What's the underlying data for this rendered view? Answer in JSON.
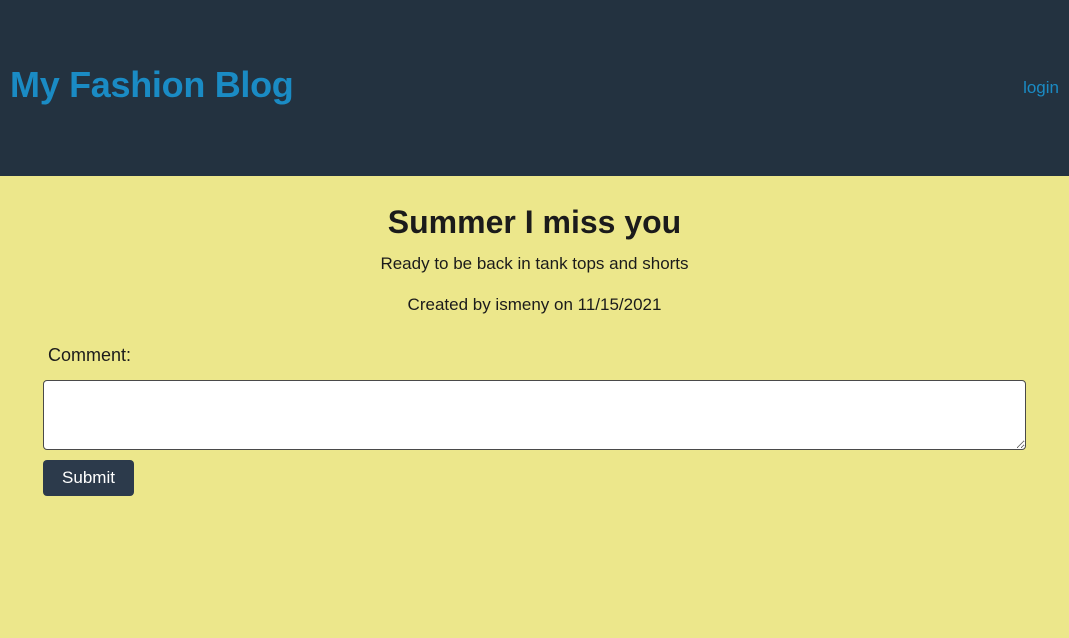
{
  "header": {
    "title": "My Fashion Blog",
    "login_label": "login"
  },
  "post": {
    "title": "Summer I miss you",
    "body": "Ready to be back in tank tops and shorts",
    "meta": "Created by ismeny on 11/15/2021"
  },
  "comment_form": {
    "label": "Comment:",
    "value": "",
    "placeholder": "",
    "submit_label": "Submit"
  },
  "colors": {
    "header_background": "#233240",
    "page_background": "#ece78b",
    "link": "#1a8bc4",
    "button_background": "#2c3a4b"
  }
}
